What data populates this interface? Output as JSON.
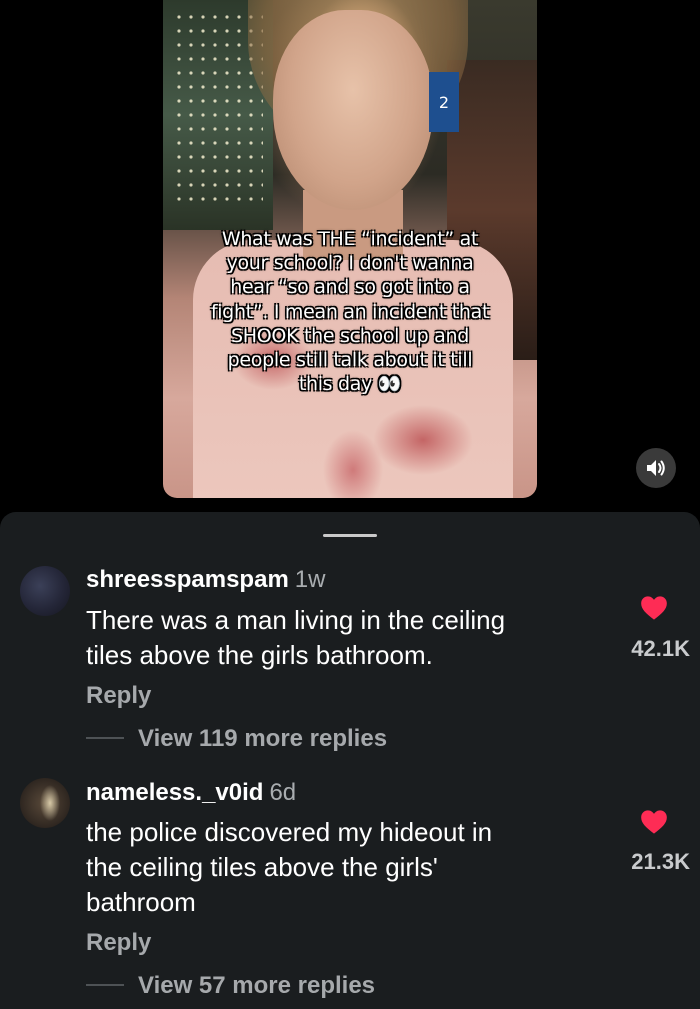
{
  "video": {
    "overlay_lines": [
      "What was THE “incident” at",
      "your school? I don't wanna",
      "hear “so and so got into a",
      "fight”. I mean an incident that",
      "SHOOK the school up and",
      "people still talk about it till",
      "this day 👀"
    ],
    "badge_text": "2",
    "volume_icon": "speaker-icon"
  },
  "comments": [
    {
      "username": "shreesspamspam",
      "time": "1w",
      "text_lines": [
        "There was a man living in the ceiling",
        "tiles above the girls bathroom."
      ],
      "likes": "42.1K",
      "reply_label": "Reply",
      "view_replies": "View 119 more replies"
    },
    {
      "username": "nameless._v0id",
      "time": "6d",
      "text_lines": [
        "the police discovered my hideout in",
        "the ceiling tiles above the girls'",
        "bathroom"
      ],
      "likes": "21.3K",
      "reply_label": "Reply",
      "view_replies": "View 57 more replies"
    }
  ],
  "colors": {
    "background": "#000000",
    "sheet": "#1a1d1f",
    "heart": "#fe2c55",
    "secondary_text": "#a6a9ac"
  }
}
